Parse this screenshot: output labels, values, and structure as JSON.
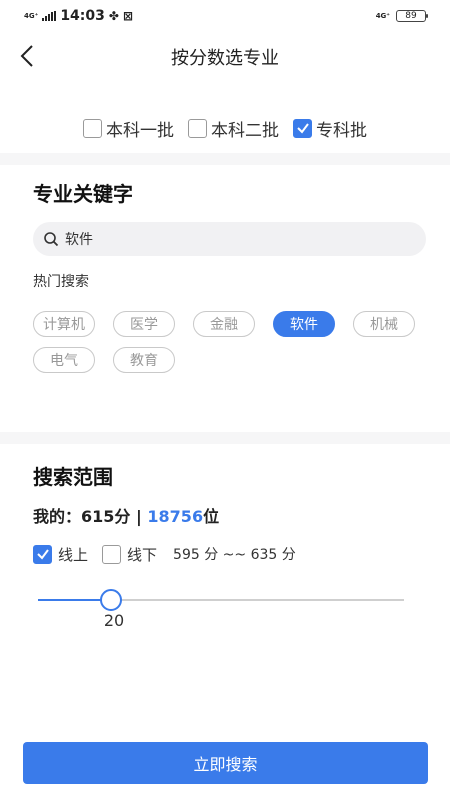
{
  "status_bar": {
    "network_left": "4G⁺",
    "time": "14:03",
    "network_right": "4G⁺",
    "battery": "89"
  },
  "nav": {
    "title": "按分数选专业"
  },
  "batches": [
    {
      "label": "本科一批",
      "checked": false
    },
    {
      "label": "本科二批",
      "checked": false
    },
    {
      "label": "专科批",
      "checked": true
    }
  ],
  "keyword_section": {
    "title": "专业关键字",
    "search_value": "软件",
    "hot_label": "热门搜索",
    "hot_tags": [
      {
        "label": "计算机",
        "active": false
      },
      {
        "label": "医学",
        "active": false
      },
      {
        "label": "金融",
        "active": false
      },
      {
        "label": "软件",
        "active": true
      },
      {
        "label": "机械",
        "active": false
      },
      {
        "label": "电气",
        "active": false
      },
      {
        "label": "教育",
        "active": false
      }
    ]
  },
  "range_section": {
    "title": "搜索范围",
    "mine_label": "我的：",
    "score": "615分",
    "separator": " | ",
    "rank": "18756",
    "rank_unit": "位",
    "online_label": "线上",
    "online_checked": true,
    "offline_label": "线下",
    "offline_checked": false,
    "range_text": "595 分 ~~ 635 分",
    "slider_value": "20",
    "slider_fraction": 0.2
  },
  "submit_label": "立即搜索",
  "colors": {
    "accent": "#3a7bea",
    "divider": "#f6f6f7"
  }
}
